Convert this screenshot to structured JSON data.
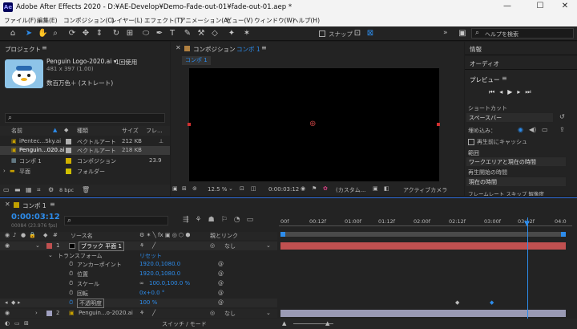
{
  "window": {
    "title": "Adobe After Effects 2020 - D:¥AE-Develop¥Demo-Fade-out-01¥fade-out-01.aep *",
    "logo": "Ae",
    "min": "—",
    "max": "☐",
    "close": "✕"
  },
  "menu": [
    "ファイル(F)",
    "編集(E)",
    "コンポジション(C)",
    "レイヤー(L)",
    "エフェクト(T)",
    "アニメーション(A)",
    "ビュー(V)",
    "ウィンドウ(W)",
    "ヘルプ(H)"
  ],
  "toolbar": {
    "snap": "スナップ",
    "search_placeholder": "ヘルプを検索",
    "more": "»"
  },
  "project": {
    "title": "プロジェクト",
    "item_name": "Penguin Logo-2020.ai ▾",
    "usage": "1回使用",
    "size": "481 x 397 (1.00)",
    "color": "数百万色＋ (ストレート)",
    "search_icon": "⌕",
    "columns": {
      "name": "名前",
      "type": "種類",
      "size": "サイズ",
      "frame": "フレ..."
    },
    "items": [
      {
        "name": "iPentec...Sky.ai",
        "type": "ベクトルアート",
        "size": "212 KB",
        "color": "#b0b0b0"
      },
      {
        "name": "Penguin...020.ai",
        "type": "ベクトルアート",
        "size": "218 KB",
        "color": "#b0b0b0"
      },
      {
        "name": "コンポ 1",
        "type": "コンポジション",
        "size": "23.9",
        "color": "#d0b000"
      },
      {
        "name": "平面",
        "type": "フォルダー",
        "size": "",
        "color": "#d0c000"
      }
    ],
    "bpc": "8 bpc"
  },
  "comp": {
    "title": "コンポジション",
    "name": "コンポ 1",
    "tab": "コンポ 1",
    "zoom": "12.5 %",
    "time": "0:00:03:12",
    "view": "(カスタム...",
    "camera": "アクティブカメラ"
  },
  "right": {
    "info": "情報",
    "audio": "オーディオ",
    "preview": "プレビュー",
    "shortcut_label": "ショートカット",
    "shortcut": "スペースバー",
    "include": "埋め込み：",
    "cache": "再生前にキャッシュ",
    "range_label": "範囲",
    "range": "ワークエリアと現在の時間",
    "start_label": "再生開始の時間",
    "start": "現在の時間",
    "extra": "フレームレート  スキップ  解像度"
  },
  "timeline": {
    "tab": "コンポ 1",
    "time": "0:00:03:12",
    "frames": "00084 (23.976 fps)",
    "search_icon": "⌕",
    "col_source": "ソース名",
    "col_parent": "親とリンク",
    "switch_mode": "スイッチ / モード",
    "ticks": [
      "00f",
      "00:12f",
      "01:00f",
      "01:12f",
      "02:00f",
      "02:12f",
      "03:00f",
      "03:12f",
      "04:0"
    ],
    "layers": [
      {
        "num": "1",
        "name": "ブラック 平面 1",
        "parent": "なし",
        "color": "#c05050"
      },
      {
        "num": "2",
        "name": "Penguin...o-2020.ai",
        "parent": "なし",
        "color": "#a0a0c0"
      }
    ],
    "transform": "トランスフォーム",
    "reset": "リセット",
    "props": [
      {
        "name": "アンカーポイント",
        "value": "1920.0,1080.0"
      },
      {
        "name": "位置",
        "value": "1920.0,1080.0"
      },
      {
        "name": "スケール",
        "value": "100.0,100.0 %"
      },
      {
        "name": "回転",
        "value": "0x+0.0 °"
      },
      {
        "name": "不透明度",
        "value": "100 %"
      }
    ]
  }
}
